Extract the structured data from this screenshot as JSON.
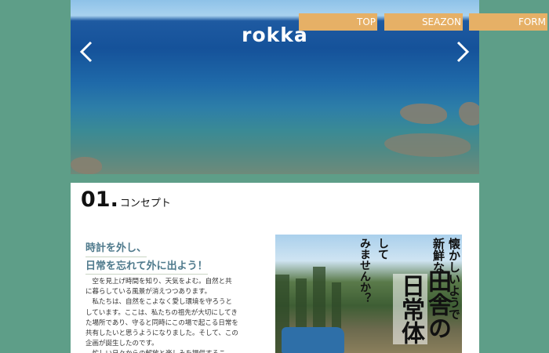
{
  "site": {
    "title": "rokka"
  },
  "nav": {
    "top": "TOP",
    "season": "SEAZON",
    "form": "FORM"
  },
  "section": {
    "number": "01.",
    "label": "コンセプト",
    "catch_1": "時計を外し、",
    "catch_2": "日常を忘れて外に出よう！",
    "body": "　空を見上げ時間を知り、天気をよむ。自然と共に暮らしている風景が消えつつあります。\n　私たちは、自然をこよなく愛し環境を守ろうとしています。ここは、私たちの祖先が大切にしてきた場所であり、守ると同時にこの場で起こる日常を共有したいと思うようになりました。そして、この企画が誕生したのです。\n　忙しい日々からの解放と楽しみを提供するこ"
  },
  "photo": {
    "line_1": "懐かしいようで",
    "line_2": "新鮮な",
    "line_3": "して",
    "line_4": "みませんか？",
    "line_5": "田舎の",
    "line_6": "日常体"
  },
  "colors": {
    "background": "#5e9e88",
    "nav": "#e6b066",
    "catch": "#4f7a8c"
  },
  "icons": {
    "prev": "chevron-left-icon",
    "next": "chevron-right-icon"
  }
}
